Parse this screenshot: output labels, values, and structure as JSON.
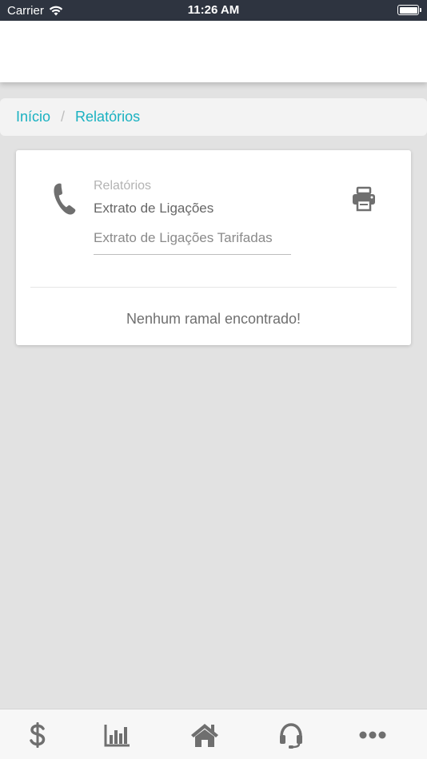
{
  "status_bar": {
    "carrier": "Carrier",
    "time": "11:26 AM"
  },
  "breadcrumb": {
    "items": [
      "Início",
      "Relatórios"
    ],
    "separator": "/"
  },
  "report_card": {
    "section_label": "Relatórios",
    "title": "Extrato de Ligações",
    "selected_report": "Extrato de Ligações Tarifadas",
    "empty_message": "Nenhum ramal encontrado!"
  },
  "tab_bar": {
    "tabs": [
      {
        "icon": "dollar-icon"
      },
      {
        "icon": "bar-chart-icon"
      },
      {
        "icon": "home-icon"
      },
      {
        "icon": "headset-icon"
      },
      {
        "icon": "more-icon"
      }
    ]
  },
  "colors": {
    "accent": "#19b1c1",
    "icon_gray": "#6f6f6f",
    "status_bar_bg": "#2e3440",
    "page_bg": "#e2e2e2"
  }
}
